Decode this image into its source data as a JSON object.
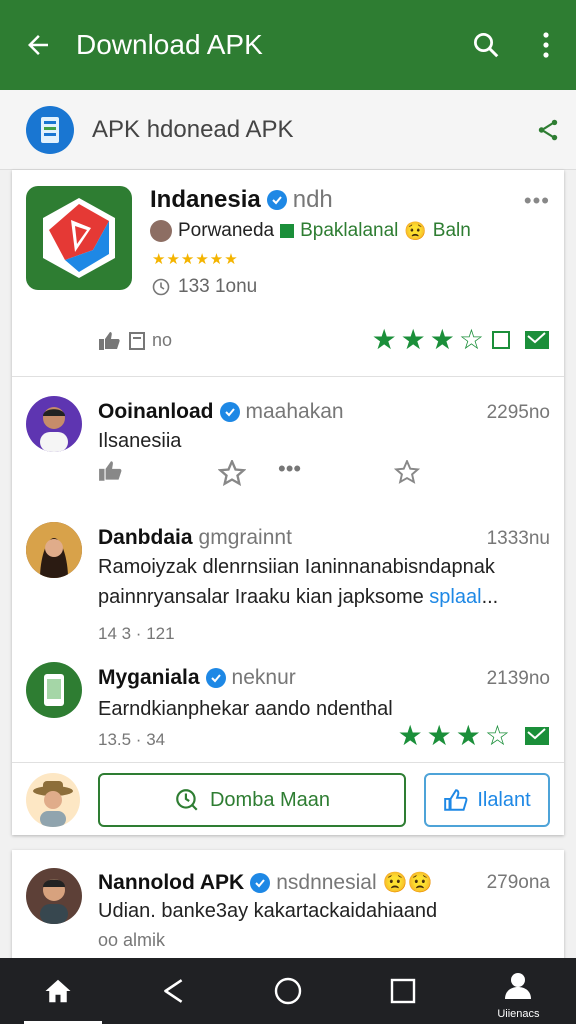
{
  "header": {
    "title": "Download APK",
    "back_icon": "arrow-back-icon",
    "search_icon": "search-icon",
    "menu_icon": "more-vertical-icon"
  },
  "source": {
    "title": "APK hdonead APK",
    "share_icon": "share-icon"
  },
  "app": {
    "name": "Indanesia",
    "name_suffix": "ndh",
    "dev_prefix": "Porwaneda",
    "dev_link": "Bpaklalanal",
    "dev_suffix": "Baln",
    "stars": "★★★★★★",
    "downloads": "133 1onu",
    "likes": "no",
    "rating_color": "#1b8f3a"
  },
  "comments": [
    {
      "name": "Ooinanload",
      "handle": "maahakan",
      "time": "2295no",
      "text": "Ilsanesiia"
    },
    {
      "name": "Danbdaia",
      "handle": "gmgrainnt",
      "time": "1333nu",
      "text1": "Ramoiyzak dlenrnsiian Ianinnanabisndapnak",
      "text2_a": "painnryansalar Iraaku kian japksome",
      "text2_link": "splaal",
      "text2_b": "...",
      "meta": "14 3 · 121"
    },
    {
      "name": "Myganiala",
      "handle": "neknur",
      "time": "2139no",
      "text": "Earndkianphekar aando ndenthal",
      "meta": "13.5 · 34"
    }
  ],
  "cta": {
    "primary": "Domba Maan",
    "secondary": "Ilalant"
  },
  "card2": {
    "name": "Nannolod APK",
    "handle": "nsdnnesial",
    "time": "279ona",
    "text": "Udian. banke3ay kakartackaidahiaand",
    "meta": "oo almik"
  },
  "nav": {
    "profile_label": "Uiienacs"
  }
}
